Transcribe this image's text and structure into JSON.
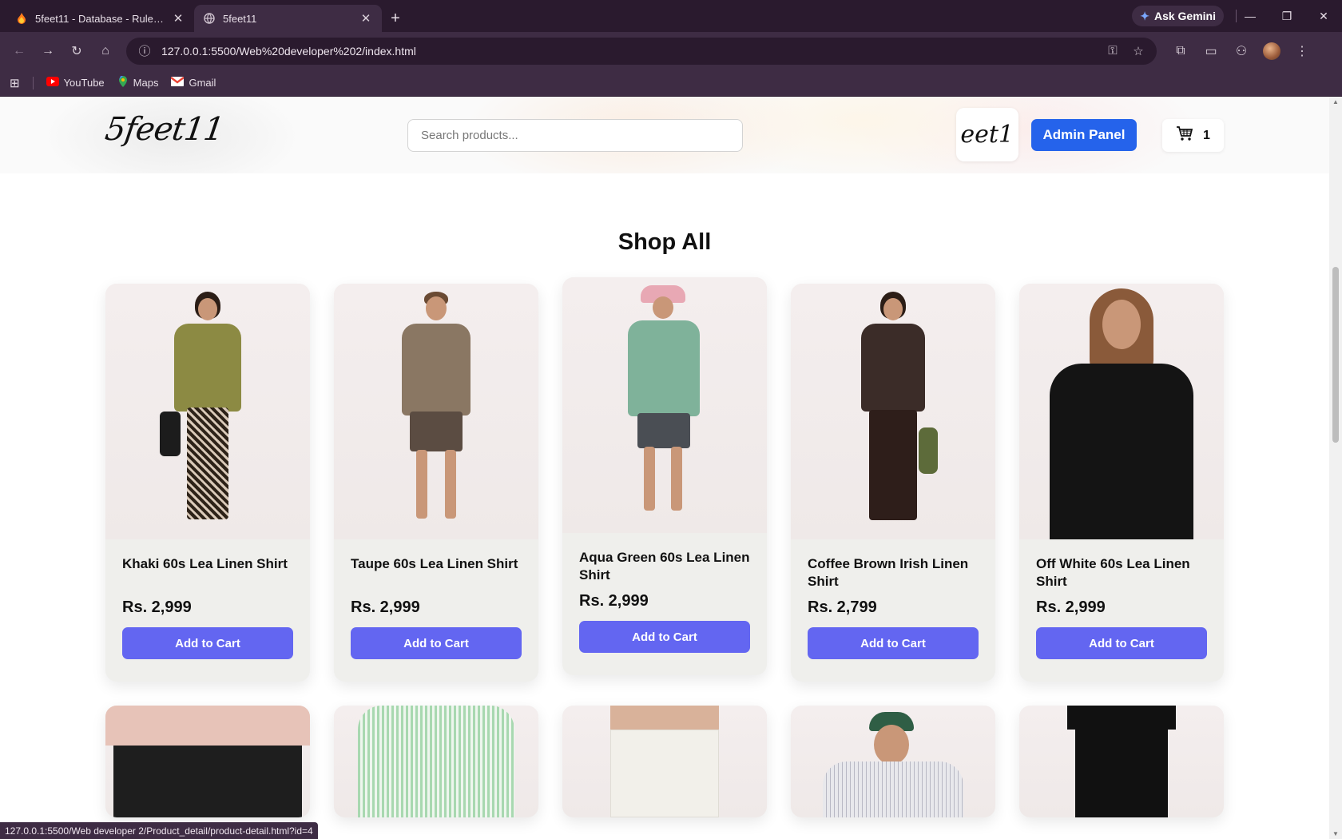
{
  "browser": {
    "tabs": [
      {
        "title": "5feet11 - Database - Rules - Fir",
        "icon": "firebase-icon",
        "active": false
      },
      {
        "title": "5feet11",
        "icon": "globe-icon",
        "active": true
      }
    ],
    "gemini_label": "Ask Gemini",
    "url": "127.0.0.1:5500/Web%20developer%202/index.html",
    "bookmarks": [
      {
        "label": "YouTube",
        "icon": "youtube-icon"
      },
      {
        "label": "Maps",
        "icon": "maps-icon"
      },
      {
        "label": "Gmail",
        "icon": "gmail-icon"
      }
    ],
    "status_url": "127.0.0.1:5500/Web developer 2/Product_detail/product-detail.html?id=4"
  },
  "header": {
    "logo_text": "5feet11",
    "mini_logo_text": "eet1",
    "search_placeholder": "Search products...",
    "admin_label": "Admin Panel",
    "cart_count": "1"
  },
  "shop": {
    "title": "Shop All",
    "products": [
      {
        "name": "Khaki 60s Lea Linen Shirt",
        "price": "Rs. 2,999",
        "button": "Add to Cart",
        "shirt_color": "#8c8a43",
        "bottom_color": "#2d2218"
      },
      {
        "name": "Taupe 60s Lea Linen Shirt",
        "price": "Rs. 2,999",
        "button": "Add to Cart",
        "shirt_color": "#8a7763",
        "bottom_color": "#5b4c42"
      },
      {
        "name": "Aqua Green 60s Lea Linen Shirt",
        "price": "Rs. 2,999",
        "button": "Add to Cart",
        "shirt_color": "#7fb29a",
        "bottom_color": "#4a4e54"
      },
      {
        "name": "Coffee Brown Irish Linen Shirt",
        "price": "Rs. 2,799",
        "button": "Add to Cart",
        "shirt_color": "#3b2c28",
        "bottom_color": "#2e1e1a"
      },
      {
        "name": "Off White 60s Lea Linen Shirt",
        "price": "Rs. 2,999",
        "button": "Add to Cart",
        "shirt_color": "#141414",
        "bottom_color": "#141414"
      }
    ],
    "row2_colors": [
      "#1e1e1e",
      "#a8d8b0",
      "#f2f0ea",
      "#e8e8ec",
      "#111111"
    ]
  }
}
